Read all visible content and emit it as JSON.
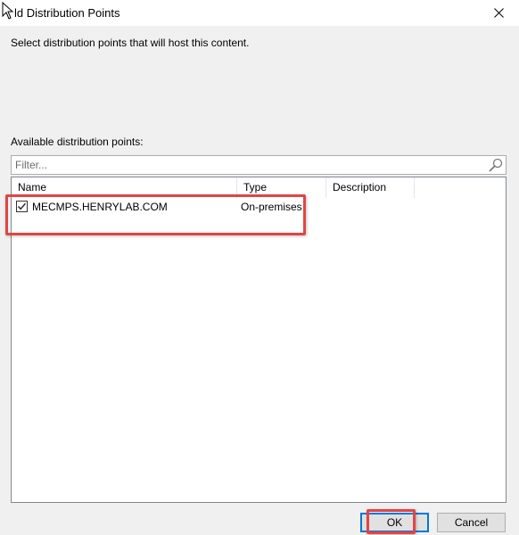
{
  "window": {
    "title": "ld Distribution Points"
  },
  "main": {
    "instructions": "Select distribution points that will host this content.",
    "available_label": "Available distribution points:",
    "filter": {
      "placeholder": "Filter...",
      "value": ""
    }
  },
  "list": {
    "columns": [
      "Name",
      "Type",
      "Description"
    ],
    "rows": [
      {
        "checked": true,
        "name": "MECMPS.HENRYLAB.COM",
        "type": "On-premises",
        "description": ""
      }
    ]
  },
  "buttons": {
    "ok": "OK",
    "cancel": "Cancel"
  },
  "icons": {
    "close": "close-icon",
    "search": "search-icon",
    "check": "checkmark-icon",
    "cursor": "mouse-cursor-icon"
  },
  "colors": {
    "highlight": "#e04545",
    "focus_blue": "#0078d7",
    "dialog_bg": "#f0f0f0"
  }
}
